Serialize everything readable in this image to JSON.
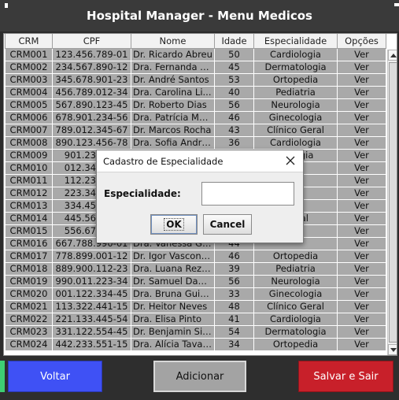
{
  "window": {
    "title": "Hospital Manager - Menu Medicos"
  },
  "table": {
    "columns": [
      "CRM",
      "CPF",
      "Nome",
      "Idade",
      "Especialidade",
      "Opções"
    ],
    "rows": [
      [
        "CRM001",
        "123.456.789-01",
        "Dr. Ricardo Abreu",
        "50",
        "Cardiologia",
        "Ver"
      ],
      [
        "CRM002",
        "234.567.890-12",
        "Dra. Fernanda C...",
        "45",
        "Dermatologia",
        "Ver"
      ],
      [
        "CRM003",
        "345.678.901-23",
        "Dr. André Santos",
        "53",
        "Ortopedia",
        "Ver"
      ],
      [
        "CRM004",
        "456.789.012-34",
        "Dra. Carolina Li...",
        "40",
        "Pediatria",
        "Ver"
      ],
      [
        "CRM005",
        "567.890.123-45",
        "Dr. Roberto Dias",
        "56",
        "Neurologia",
        "Ver"
      ],
      [
        "CRM006",
        "678.901.234-56",
        "Dra. Patrícia Melo",
        "46",
        "Ginecologia",
        "Ver"
      ],
      [
        "CRM007",
        "789.012.345-67",
        "Dr. Marcos Rocha",
        "43",
        "Clínico Geral",
        "Ver"
      ],
      [
        "CRM008",
        "890.123.456-78",
        "Dra. Sofia Andrade",
        "36",
        "Cardiologia",
        "Ver"
      ],
      [
        "CRM009",
        "901.234.5...",
        "",
        "",
        "...ologia",
        "Ver"
      ],
      [
        "CRM010",
        "012.345.6...",
        "",
        "",
        "",
        "Ver"
      ],
      [
        "CRM011",
        "112.233.4...",
        "",
        "",
        "...ia",
        "Ver"
      ],
      [
        "CRM012",
        "223.344.5...",
        "",
        "",
        "",
        "Ver"
      ],
      [
        "CRM013",
        "334.455.6...",
        "",
        "",
        "",
        "Ver"
      ],
      [
        "CRM014",
        "445.566.7...",
        "",
        "",
        "...eral",
        "Ver"
      ],
      [
        "CRM015",
        "556.677.8...",
        "",
        "",
        "",
        "Ver"
      ],
      [
        "CRM016",
        "667.788.990-01",
        "Dra. Vanessa Go...",
        "44",
        "",
        "Ver"
      ],
      [
        "CRM017",
        "778.899.001-12",
        "Dr. Igor Vasconc...",
        "46",
        "Ortopedia",
        "Ver"
      ],
      [
        "CRM018",
        "889.900.112-23",
        "Dra. Luana Reze...",
        "39",
        "Pediatria",
        "Ver"
      ],
      [
        "CRM019",
        "990.011.223-34",
        "Dr. Samuel Dant...",
        "56",
        "Neurologia",
        "Ver"
      ],
      [
        "CRM020",
        "001.122.334-45",
        "Dra. Bruna Guim...",
        "33",
        "Ginecologia",
        "Ver"
      ],
      [
        "CRM021",
        "113.322.441-15",
        "Dr. Heitor Neves",
        "48",
        "Clínico Geral",
        "Ver"
      ],
      [
        "CRM022",
        "221.133.445-54",
        "Dra. Elisa Pinto",
        "41",
        "Cardiologia",
        "Ver"
      ],
      [
        "CRM023",
        "331.122.554-45",
        "Dr. Benjamin Silv...",
        "54",
        "Dermatologia",
        "Ver"
      ],
      [
        "CRM024",
        "442.233.551-15",
        "Dra. Alícia Tavares",
        "34",
        "Ortopedia",
        "Ver"
      ]
    ]
  },
  "dialog": {
    "title": "Cadastro de Especialidade",
    "close_icon": "close-icon",
    "field_label": "Especialidade:",
    "field_value": "",
    "ok_label": "OK",
    "cancel_label": "Cancel"
  },
  "buttons": {
    "voltar": "Voltar",
    "adicionar": "Adicionar",
    "salvar": "Salvar e Sair"
  },
  "colors": {
    "title_bar": "#3a3a3a",
    "row_bg": "#a9a9a9",
    "voltar": "#3f51f5",
    "adicionar": "#a3a3a3",
    "salvar": "#c8202a",
    "accent": "#3ecf73"
  }
}
